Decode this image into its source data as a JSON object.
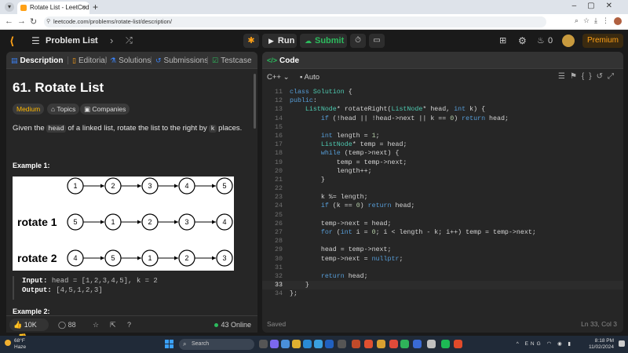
{
  "browser": {
    "tab_title": "Rotate List - LeetCode",
    "url": "leetcode.com/problems/rotate-list/description/"
  },
  "header": {
    "problem_list": "Problem List",
    "run": "Run",
    "submit": "Submit",
    "streak_count": "0",
    "premium": "Premium"
  },
  "left_tabs": {
    "description": "Description",
    "editorial": "Editorial",
    "solutions": "Solutions",
    "submissions": "Submissions",
    "testcase": "Testcase"
  },
  "problem": {
    "title": "61. Rotate List",
    "difficulty": "Medium",
    "topics": "Topics",
    "companies": "Companies",
    "desc_pre": "Given the ",
    "desc_code1": "head",
    "desc_mid": " of a linked list, rotate the list to the right by ",
    "desc_code2": "k",
    "desc_post": " places.",
    "example1_label": "Example 1:",
    "example2_label": "Example 2:",
    "input_label": "Input:",
    "input_value": "head = [1,2,3,4,5], k = 2",
    "output_label": "Output:",
    "output_value": "[4,5,1,2,3]"
  },
  "diagram": {
    "rows": [
      {
        "label": "",
        "nodes": [
          "1",
          "2",
          "3",
          "4",
          "5"
        ]
      },
      {
        "label": "rotate 1",
        "nodes": [
          "5",
          "1",
          "2",
          "3",
          "4"
        ]
      },
      {
        "label": "rotate 2",
        "nodes": [
          "4",
          "5",
          "1",
          "2",
          "3"
        ]
      }
    ]
  },
  "footer": {
    "likes": "10K",
    "comments": "88",
    "online": "43 Online"
  },
  "editor": {
    "panel_title": "Code",
    "language": "C++",
    "mode": "Auto",
    "status": "Saved",
    "cursor": "Ln 33, Col 3",
    "current_line": 33,
    "lines": [
      {
        "n": "11",
        "t": "class Solution {"
      },
      {
        "n": "12",
        "t": "public:"
      },
      {
        "n": "13",
        "t": "    ListNode* rotateRight(ListNode* head, int k) {"
      },
      {
        "n": "14",
        "t": "        if (!head || !head->next || k == 0) return head;"
      },
      {
        "n": "15",
        "t": ""
      },
      {
        "n": "16",
        "t": "        int length = 1;"
      },
      {
        "n": "17",
        "t": "        ListNode* temp = head;"
      },
      {
        "n": "18",
        "t": "        while (temp->next) {"
      },
      {
        "n": "19",
        "t": "            temp = temp->next;"
      },
      {
        "n": "20",
        "t": "            length++;"
      },
      {
        "n": "21",
        "t": "        }"
      },
      {
        "n": "22",
        "t": ""
      },
      {
        "n": "23",
        "t": "        k %= length;"
      },
      {
        "n": "24",
        "t": "        if (k == 0) return head;"
      },
      {
        "n": "25",
        "t": ""
      },
      {
        "n": "26",
        "t": "        temp->next = head;"
      },
      {
        "n": "27",
        "t": "        for (int i = 0; i < length - k; i++) temp = temp->next;"
      },
      {
        "n": "28",
        "t": ""
      },
      {
        "n": "29",
        "t": "        head = temp->next;"
      },
      {
        "n": "30",
        "t": "        temp->next = nullptr;"
      },
      {
        "n": "31",
        "t": ""
      },
      {
        "n": "32",
        "t": "        return head;"
      },
      {
        "n": "33",
        "t": "    }"
      },
      {
        "n": "34",
        "t": "};"
      }
    ]
  },
  "taskbar": {
    "temp": "68°F",
    "weather": "Haze",
    "search": "Search",
    "lang": "ENG",
    "time": "8:18 PM",
    "date": "11/02/2024"
  },
  "colors": {
    "accent": "#ffa116",
    "submit": "#2cbb5d",
    "medium": "#ffb800"
  }
}
